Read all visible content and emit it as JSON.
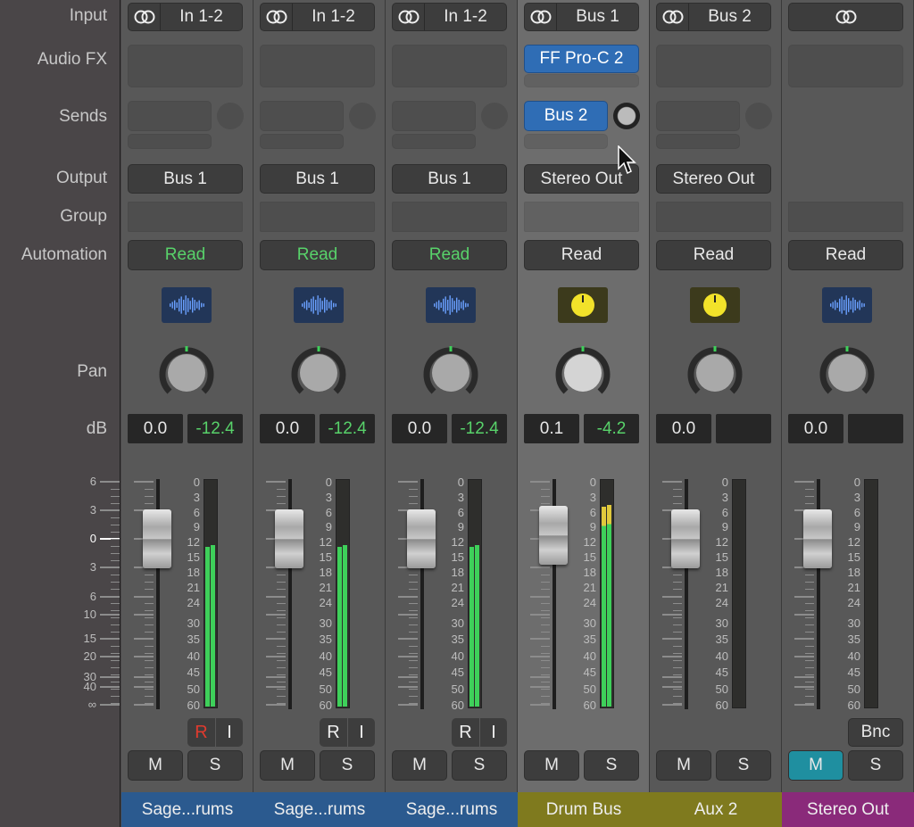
{
  "row_labels": {
    "input": "Input",
    "audio_fx": "Audio FX",
    "sends": "Sends",
    "output": "Output",
    "group": "Group",
    "automation": "Automation",
    "pan": "Pan",
    "db": "dB"
  },
  "fader_scale": [
    "6",
    "3",
    "0",
    "3",
    "6",
    "10",
    "15",
    "20",
    "30",
    "40",
    "∞"
  ],
  "meter_scale": [
    "0",
    "3",
    "6",
    "9",
    "12",
    "15",
    "18",
    "21",
    "24",
    "30",
    "35",
    "40",
    "45",
    "50",
    "60"
  ],
  "colors": {
    "automation_active": "#58d26a",
    "plugin_blue": "#2f6db5",
    "meter_green": "#3ed05a",
    "meter_yellow": "#e0c93c",
    "mute_active": "#1f8fa0"
  },
  "channels": [
    {
      "input": "In 1-2",
      "input_icon": "stereo-link-icon",
      "audio_fx": "",
      "send": "",
      "output": "Bus 1",
      "automation": "Read",
      "automation_active": true,
      "icon": "waveform-icon",
      "volume": "0.0",
      "peak": "-12.4",
      "meter_db": -13,
      "rec": "R",
      "rec_active": true,
      "input_mon": "I",
      "mute": "M",
      "solo": "S",
      "mute_active": false,
      "name": "Sage...rums",
      "name_color": "#2b5a8f",
      "selected": false
    },
    {
      "input": "In 1-2",
      "input_icon": "stereo-link-icon",
      "audio_fx": "",
      "send": "",
      "output": "Bus 1",
      "automation": "Read",
      "automation_active": true,
      "icon": "waveform-icon",
      "volume": "0.0",
      "peak": "-12.4",
      "meter_db": -13,
      "rec": "R",
      "rec_active": false,
      "input_mon": "I",
      "mute": "M",
      "solo": "S",
      "mute_active": false,
      "name": "Sage...rums",
      "name_color": "#2b5a8f",
      "selected": false
    },
    {
      "input": "In 1-2",
      "input_icon": "stereo-link-icon",
      "audio_fx": "",
      "send": "",
      "output": "Bus 1",
      "automation": "Read",
      "automation_active": true,
      "icon": "waveform-icon",
      "volume": "0.0",
      "peak": "-12.4",
      "meter_db": -13,
      "rec": "R",
      "rec_active": false,
      "input_mon": "I",
      "mute": "M",
      "solo": "S",
      "mute_active": false,
      "name": "Sage...rums",
      "name_color": "#2b5a8f",
      "selected": false
    },
    {
      "input": "Bus 1",
      "input_icon": "stereo-link-icon",
      "audio_fx": "FF Pro-C 2",
      "send": "Bus 2",
      "output": "Stereo Out",
      "automation": "Read",
      "automation_active": false,
      "icon": "aux-knob-icon",
      "volume": "0.1",
      "peak": "-4.2",
      "meter_db": -5,
      "mute": "M",
      "solo": "S",
      "mute_active": false,
      "name": "Drum Bus",
      "name_color": "#7f7a1e",
      "selected": true
    },
    {
      "input": "Bus 2",
      "input_icon": "stereo-link-icon",
      "audio_fx": "",
      "send": "",
      "output": "Stereo Out",
      "automation": "Read",
      "automation_active": false,
      "icon": "aux-knob-icon",
      "volume": "0.0",
      "peak": "",
      "meter_db": null,
      "mute": "M",
      "solo": "S",
      "mute_active": false,
      "name": "Aux 2",
      "name_color": "#7f7a1e",
      "selected": false
    },
    {
      "input": "",
      "input_icon": "stereo-link-icon",
      "audio_fx": "",
      "output": "",
      "automation": "Read",
      "automation_active": false,
      "icon": "waveform-icon",
      "volume": "0.0",
      "peak": "",
      "meter_db": null,
      "bounce": "Bnc",
      "mute": "M",
      "solo": "S",
      "mute_active": true,
      "name": "Stereo Out",
      "name_color": "#8a2a7a",
      "selected": false,
      "no_sends": true
    }
  ]
}
